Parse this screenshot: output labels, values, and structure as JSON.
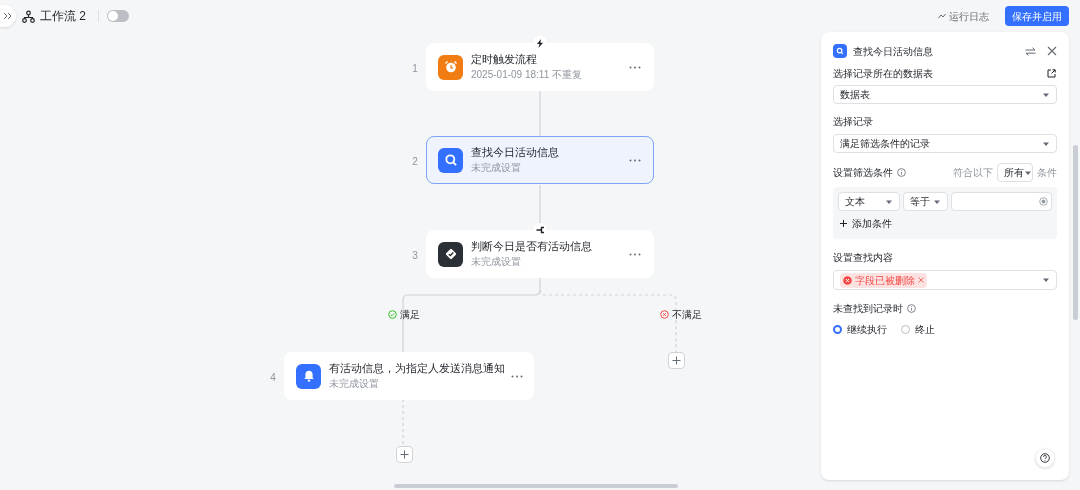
{
  "toolbar": {
    "title": "工作流 2",
    "enabled": false,
    "run_log": "运行日志",
    "save_button": "保存并启用"
  },
  "nodes": [
    {
      "number": "1",
      "kind": "timer",
      "title": "定时触发流程",
      "subtitle": "2025-01-09 18:11 不重复",
      "selected": false
    },
    {
      "number": "2",
      "kind": "search",
      "title": "查找今日活动信息",
      "subtitle": "未完成设置",
      "selected": true
    },
    {
      "number": "3",
      "kind": "condition",
      "title": "判断今日是否有活动信息",
      "subtitle": "未完成设置",
      "selected": false
    },
    {
      "number": "4",
      "kind": "notify",
      "title": "有活动信息，为指定人发送消息通知",
      "subtitle": "未完成设置",
      "selected": false
    }
  ],
  "branches": [
    {
      "kind": "yes",
      "label": "满足"
    },
    {
      "kind": "no",
      "label": "不满足"
    }
  ],
  "panel": {
    "title": "查找今日活动信息",
    "table_label": "选择记录所在的数据表",
    "table_value": "数据表",
    "record_label": "选择记录",
    "record_value": "满足筛选条件的记录",
    "filter_label": "设置筛选条件",
    "match_prefix": "符合以下",
    "match_value": "所有",
    "match_suffix": "条件",
    "filter": {
      "field": "文本",
      "operator": "等于"
    },
    "add_condition": "添加条件",
    "content_label": "设置查找内容",
    "content_tags": [
      {
        "label": "字段已被删除",
        "kind": "error"
      }
    ],
    "missing_label": "未查找到记录时",
    "options": [
      {
        "label": "继续执行",
        "selected": true
      },
      {
        "label": "终止",
        "selected": false
      }
    ]
  }
}
